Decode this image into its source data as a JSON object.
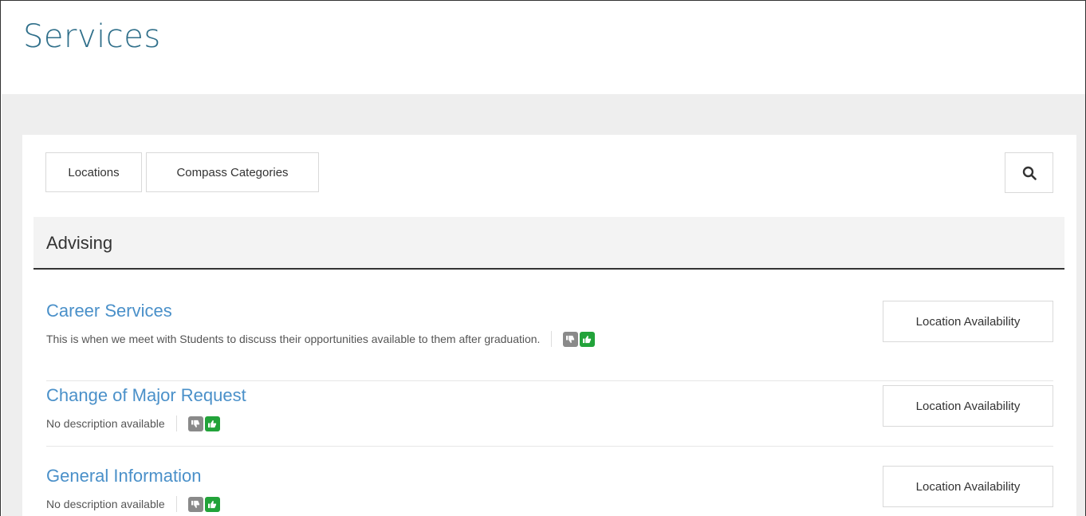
{
  "page": {
    "title": "Services"
  },
  "toolbar": {
    "tabs": [
      {
        "label": "Locations"
      },
      {
        "label": "Compass Categories"
      }
    ],
    "search_icon": "search-icon"
  },
  "section": {
    "title": "Advising",
    "services": [
      {
        "name": "Career Services",
        "description": "This is when we meet with Students to discuss their opportunities available to them after graduation.",
        "action_label": "Location Availability"
      },
      {
        "name": "Change of Major Request",
        "description": "No description available",
        "action_label": "Location Availability"
      },
      {
        "name": "General Information",
        "description": "No description available",
        "action_label": "Location Availability"
      }
    ]
  },
  "colors": {
    "title": "#2f6f8a",
    "link": "#4a90c9",
    "thumbs_up": "#22a33a",
    "thumbs_down": "#8a8a8a"
  }
}
